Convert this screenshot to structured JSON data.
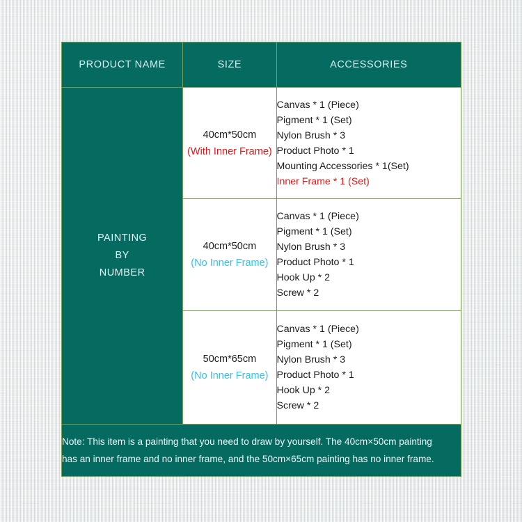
{
  "table": {
    "headers": {
      "product_name": "PRODUCT NAME",
      "size": "SIZE",
      "accessories": "ACCESSORIES"
    },
    "product_name": {
      "line1": "PAINTING",
      "line2": "BY",
      "line3": "NUMBER"
    },
    "rows": [
      {
        "size": "40cm*50cm",
        "frame_note": "(With Inner Frame)",
        "frame_note_color": "#ef1212",
        "accessories": [
          {
            "text": "Canvas * 1 (Piece)",
            "color": "#1c1c1c"
          },
          {
            "text": "Pigment * 1 (Set)",
            "color": "#1c1c1c"
          },
          {
            "text": "Nylon Brush * 3",
            "color": "#1c1c1c"
          },
          {
            "text": "Product Photo * 1",
            "color": "#1c1c1c"
          },
          {
            "text": "Mounting Accessories * 1(Set)",
            "color": "#1c1c1c"
          },
          {
            "text": "Inner Frame * 1 (Set)",
            "color": "#ef1212"
          }
        ]
      },
      {
        "size": "40cm*50cm",
        "frame_note": "(No Inner Frame)",
        "frame_note_color": "#2ec2f2",
        "accessories": [
          {
            "text": "Canvas * 1 (Piece)",
            "color": "#1c1c1c"
          },
          {
            "text": "Pigment * 1 (Set)",
            "color": "#1c1c1c"
          },
          {
            "text": "Nylon Brush * 3",
            "color": "#1c1c1c"
          },
          {
            "text": "Product Photo * 1",
            "color": "#1c1c1c"
          },
          {
            "text": "Hook Up * 2",
            "color": "#1c1c1c"
          },
          {
            "text": "Screw * 2",
            "color": "#1c1c1c"
          }
        ]
      },
      {
        "size": "50cm*65cm",
        "frame_note": "(No Inner Frame)",
        "frame_note_color": "#2ec2f2",
        "accessories": [
          {
            "text": "Canvas * 1 (Piece)",
            "color": "#1c1c1c"
          },
          {
            "text": "Pigment * 1 (Set)",
            "color": "#1c1c1c"
          },
          {
            "text": "Nylon Brush * 3",
            "color": "#1c1c1c"
          },
          {
            "text": "Product Photo * 1",
            "color": "#1c1c1c"
          },
          {
            "text": "Hook Up * 2",
            "color": "#1c1c1c"
          },
          {
            "text": "Screw * 2",
            "color": "#1c1c1c"
          }
        ]
      }
    ],
    "note": {
      "line1": "Note: This item is a painting that you need to draw by yourself. The 40cm×50cm painting",
      "line2": "has an inner frame and no inner frame, and the 50cm×65cm painting has no inner frame."
    }
  },
  "colors": {
    "teal": "#056a60",
    "border_green": "#78a050",
    "header_text": "#d4efef",
    "body_text": "#1c1c1c",
    "red": "#ef1212",
    "cyan": "#2ec2f2",
    "page_background": "#e7edee"
  }
}
